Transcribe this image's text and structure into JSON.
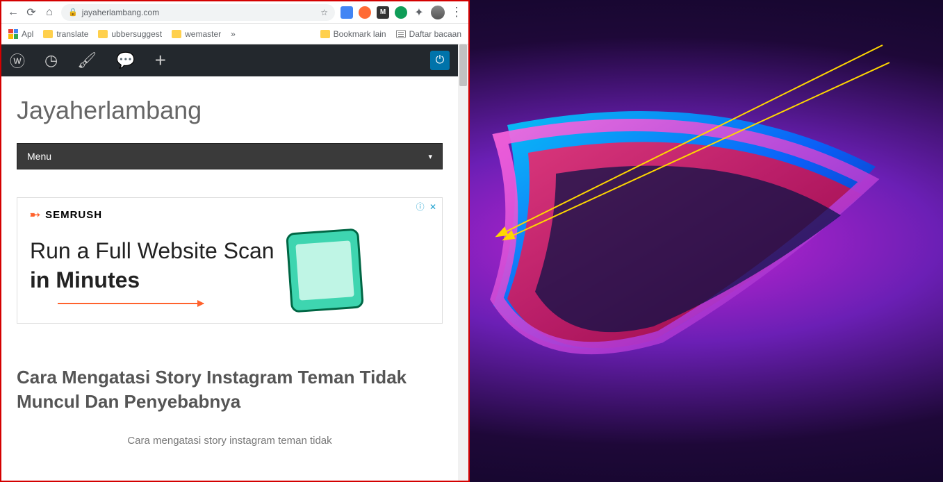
{
  "browser": {
    "url": "jayaherlambang.com",
    "star_icon": "star-icon"
  },
  "bookmarks": {
    "apps": "Apl",
    "items": [
      "translate",
      "ubbersuggest",
      "wemaster"
    ],
    "more": "»",
    "right": {
      "bookmark_lain": "Bookmark lain",
      "daftar_bacaan": "Daftar bacaan"
    }
  },
  "wp_bar": {
    "icons": [
      "wordpress",
      "gauge",
      "brush",
      "comment",
      "plus"
    ]
  },
  "site": {
    "title": "Jayaherlambang",
    "menu_label": "Menu"
  },
  "ad": {
    "brand": "SEMRUSH",
    "line1": "Run a Full Website Scan",
    "line2": "in Minutes",
    "close": "ⓘ ✕"
  },
  "article": {
    "title": "Cara Mengatasi Story Instagram Teman Tidak Muncul Dan Penyebabnya",
    "subtitle": "Cara mengatasi story instagram teman tidak"
  }
}
